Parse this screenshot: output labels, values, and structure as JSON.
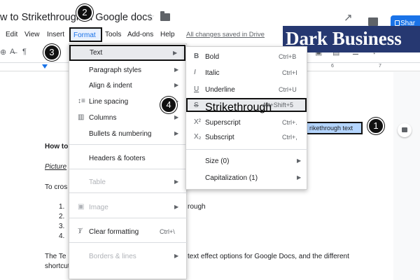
{
  "header": {
    "doc_title": "w to Strikethrough in Google docs",
    "share_label": "Shar",
    "saved_status": "All changes saved in Drive"
  },
  "menubar": [
    "Edit",
    "View",
    "Insert",
    "Format",
    "Tools",
    "Add-ons",
    "Help"
  ],
  "toolbar": {
    "icons": [
      "zoom-icon",
      "spellcheck-icon",
      "paint-format-icon",
      "bold-icon",
      "italic-icon",
      "underline-icon",
      "text-color-icon",
      "link-icon",
      "comment-icon",
      "image-icon",
      "align-icon",
      "line-spacing-icon"
    ],
    "ruler_numbers": [
      "6",
      "7"
    ]
  },
  "watermark": "Dark Business",
  "format_menu": {
    "items": [
      {
        "label": "Text",
        "icon": "",
        "has_submenu": true,
        "disabled": false,
        "shortcut": ""
      },
      {
        "label": "Paragraph styles",
        "icon": "",
        "has_submenu": true,
        "disabled": false,
        "shortcut": ""
      },
      {
        "label": "Align & indent",
        "icon": "",
        "has_submenu": true,
        "disabled": false,
        "shortcut": ""
      },
      {
        "label": "Line spacing",
        "icon": "line-spacing-icon",
        "has_submenu": true,
        "disabled": false,
        "shortcut": ""
      },
      {
        "label": "Columns",
        "icon": "columns-icon",
        "has_submenu": true,
        "disabled": false,
        "shortcut": ""
      },
      {
        "label": "Bullets & numbering",
        "icon": "",
        "has_submenu": true,
        "disabled": false,
        "shortcut": ""
      },
      {
        "label": "Headers & footers",
        "icon": "",
        "has_submenu": false,
        "disabled": false,
        "shortcut": ""
      },
      {
        "label": "Table",
        "icon": "",
        "has_submenu": true,
        "disabled": true,
        "shortcut": ""
      },
      {
        "label": "Image",
        "icon": "image-icon",
        "has_submenu": true,
        "disabled": true,
        "shortcut": ""
      },
      {
        "label": "Clear formatting",
        "icon": "clear-formatting-icon",
        "has_submenu": false,
        "disabled": false,
        "shortcut": "Ctrl+\\"
      },
      {
        "label": "Borders & lines",
        "icon": "",
        "has_submenu": true,
        "disabled": true,
        "shortcut": ""
      }
    ]
  },
  "text_menu": {
    "items": [
      {
        "label": "Bold",
        "icon_glyph": "B",
        "shortcut": "Ctrl+B",
        "has_submenu": false
      },
      {
        "label": "Italic",
        "icon_glyph": "I",
        "shortcut": "Ctrl+I",
        "has_submenu": false
      },
      {
        "label": "Underline",
        "icon_glyph": "U",
        "shortcut": "Ctrl+U",
        "has_submenu": false
      },
      {
        "label": "Strikethrough",
        "icon_glyph": "S",
        "shortcut": "Alt+Shift+5",
        "has_submenu": false
      },
      {
        "label": "Superscript",
        "icon_glyph": "X²",
        "shortcut": "Ctrl+.",
        "has_submenu": false
      },
      {
        "label": "Subscript",
        "icon_glyph": "X₂",
        "shortcut": "Ctrl+,",
        "has_submenu": false
      },
      {
        "label": "Size (0)",
        "icon_glyph": "",
        "shortcut": "",
        "has_submenu": true
      },
      {
        "label": "Capitalization (1)",
        "icon_glyph": "",
        "shortcut": "",
        "has_submenu": true
      }
    ]
  },
  "document": {
    "heading": "How to",
    "picture_link": "Picture",
    "intro": "To cros",
    "list_numbers": [
      "1.",
      "2.",
      "3.",
      "4."
    ],
    "list_item_tail": "rough",
    "selected_text": "rikethrough text",
    "para_start": "The Te",
    "para_tail": "text effect options for Google Docs, and the different",
    "shortcuts_line": "shortcuts for them."
  },
  "badges": [
    "1",
    "2",
    "3",
    "4"
  ],
  "colors": {
    "accent": "#1a73e8",
    "badge": "#111111",
    "watermark_bg": "#263871",
    "selection": "#b4d5fe"
  }
}
